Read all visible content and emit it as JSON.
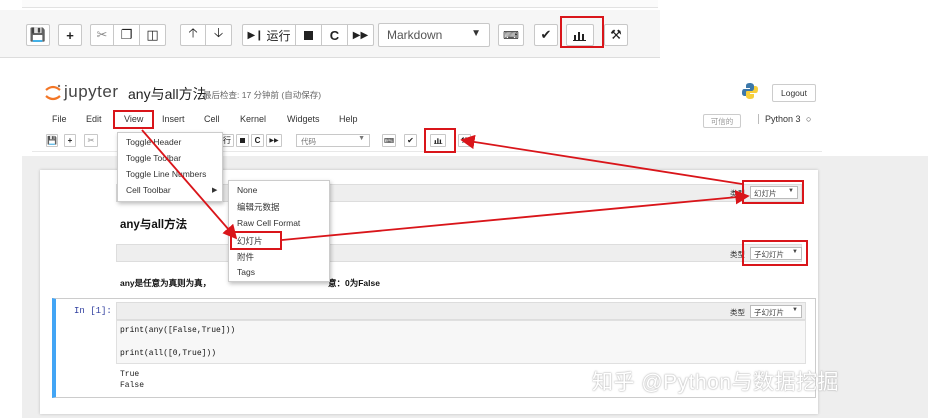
{
  "top_toolbar": {
    "run_label": "运行",
    "cell_type_value": "Markdown"
  },
  "header": {
    "logo_text": "jupyter",
    "notebook_name": "any与all方法",
    "checkpoint": "最后检查: 17 分钟前  (自动保存)",
    "logout_label": "Logout"
  },
  "menubar": {
    "items": [
      "File",
      "Edit",
      "View",
      "Insert",
      "Cell",
      "Kernel",
      "Widgets",
      "Help"
    ],
    "trusted_label": "可信的",
    "kernel_label": "Python 3"
  },
  "mini_toolbar": {
    "run_label": "行",
    "cell_type_value": "代码"
  },
  "view_menu": {
    "items": [
      "Toggle Header",
      "Toggle Toolbar",
      "Toggle Line Numbers",
      "Cell Toolbar"
    ]
  },
  "cell_toolbar_submenu": {
    "items": [
      "None",
      "编辑元数据",
      "Raw Cell Format",
      "幻灯片",
      "附件",
      "Tags"
    ]
  },
  "cells": {
    "type_label": "类型",
    "cell1_type": "幻灯片",
    "cell1_heading": "any与all方法",
    "cell2_type": "子幻灯片",
    "cell2_text": "any是任意为真则为真，",
    "cell2_text_tail": "意：0为False",
    "cell3_type": "子幻灯片",
    "cell3_prompt": "In  [1]:",
    "code_line1": "print(any([False,True]))",
    "code_line2": "print(all([0,True]))",
    "output_line1": "True",
    "output_line2": "False"
  },
  "watermark": "知乎 @Python与数据挖掘",
  "colors": {
    "annotation_red": "#d9151a",
    "code_cell_border": "#42a5f5",
    "prompt_blue": "#303f9f"
  }
}
